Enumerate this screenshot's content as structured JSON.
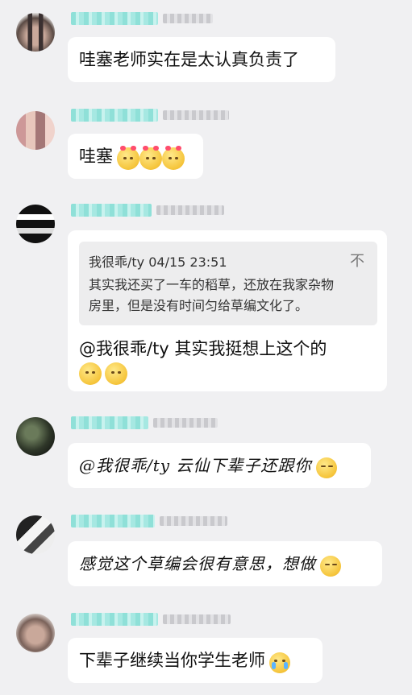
{
  "messages": [
    {
      "text": "哇塞老师实在是太认真负责了"
    },
    {
      "text": "哇塞"
    },
    {
      "quote": {
        "author": "我很乖/ty",
        "time": "04/15 23:51",
        "line1": "其实我还买了一车的稻草，还放在我家杂物",
        "line2": "房里，但是没有时间匀给草编文化了。",
        "collapse_icon": "collapse-icon"
      },
      "text": "@我很乖/ty 其实我挺想上这个的"
    },
    {
      "text": "@我很乖/ty 云仙下辈子还跟你"
    },
    {
      "text": "感觉这个草编会很有意思，想做"
    },
    {
      "text": "下辈子继续当你学生老师"
    }
  ],
  "colors": {
    "background": "#f0f0f2",
    "bubble": "#ffffff",
    "tag": "#8fe0d8"
  }
}
